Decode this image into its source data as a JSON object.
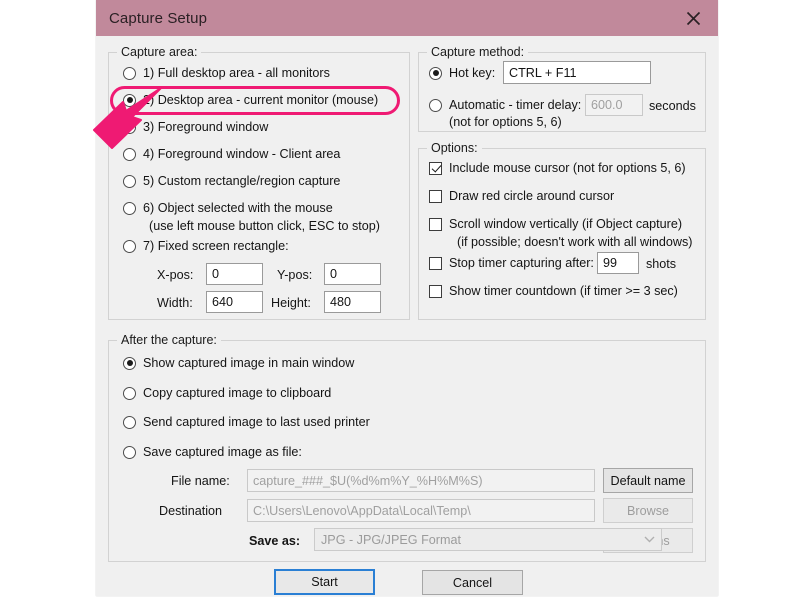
{
  "window": {
    "title": "Capture Setup",
    "close_icon": "close-icon",
    "titlebar_color": "#c1899b",
    "accent_highlight_color": "#ef1a73"
  },
  "capture_area": {
    "legend": "Capture area:",
    "selected_index": 1,
    "options": [
      "1) Full desktop area - all monitors",
      "2) Desktop area - current monitor (mouse)",
      "3) Foreground window",
      "4) Foreground window - Client area",
      "5) Custom rectangle/region capture",
      "6) Object selected with the mouse",
      "7) Fixed screen rectangle:"
    ],
    "option6_note": "(use left mouse button click, ESC to stop)",
    "fields": {
      "xpos_label": "X-pos:",
      "xpos_value": "0",
      "ypos_label": "Y-pos:",
      "ypos_value": "0",
      "width_label": "Width:",
      "width_value": "640",
      "height_label": "Height:",
      "height_value": "480"
    }
  },
  "capture_method": {
    "legend": "Capture method:",
    "hotkey_label": "Hot key:",
    "hotkey_value": "CTRL + F11",
    "hotkey_selected": true,
    "auto_label": "Automatic - timer delay:",
    "auto_note": "(not for options 5, 6)",
    "auto_value": "600.0",
    "auto_unit": "seconds",
    "auto_selected": false
  },
  "options": {
    "legend": "Options:",
    "items": [
      {
        "label": "Include mouse cursor (not for options 5, 6)",
        "checked": true
      },
      {
        "label": "Draw red circle around cursor",
        "checked": false
      },
      {
        "label": "Scroll window vertically (if Object capture)",
        "checked": false
      },
      {
        "label": "Stop timer capturing after:",
        "checked": false
      },
      {
        "label": "Show timer countdown (if timer >= 3 sec)",
        "checked": false
      }
    ],
    "scroll_note": "(if possible; doesn't work with all windows)",
    "shots_value": "99",
    "shots_unit": "shots"
  },
  "after_capture": {
    "legend": "After the capture:",
    "selected_index": 0,
    "options": [
      "Show captured image in main window",
      "Copy captured image to clipboard",
      "Send captured image to last used printer",
      "Save captured image as file:"
    ],
    "filename_label": "File name:",
    "filename_value": "capture_###_$U(%d%m%Y_%H%M%S)",
    "default_name_button": "Default name",
    "destination_label": "Destination",
    "destination_value": "C:\\Users\\Lenovo\\AppData\\Local\\Temp\\",
    "browse_button": "Browse",
    "saveas_label": "Save as:",
    "saveas_value": "JPG - JPG/JPEG Format",
    "options_button": "Options"
  },
  "footer": {
    "start_button": "Start",
    "cancel_button": "Cancel"
  }
}
